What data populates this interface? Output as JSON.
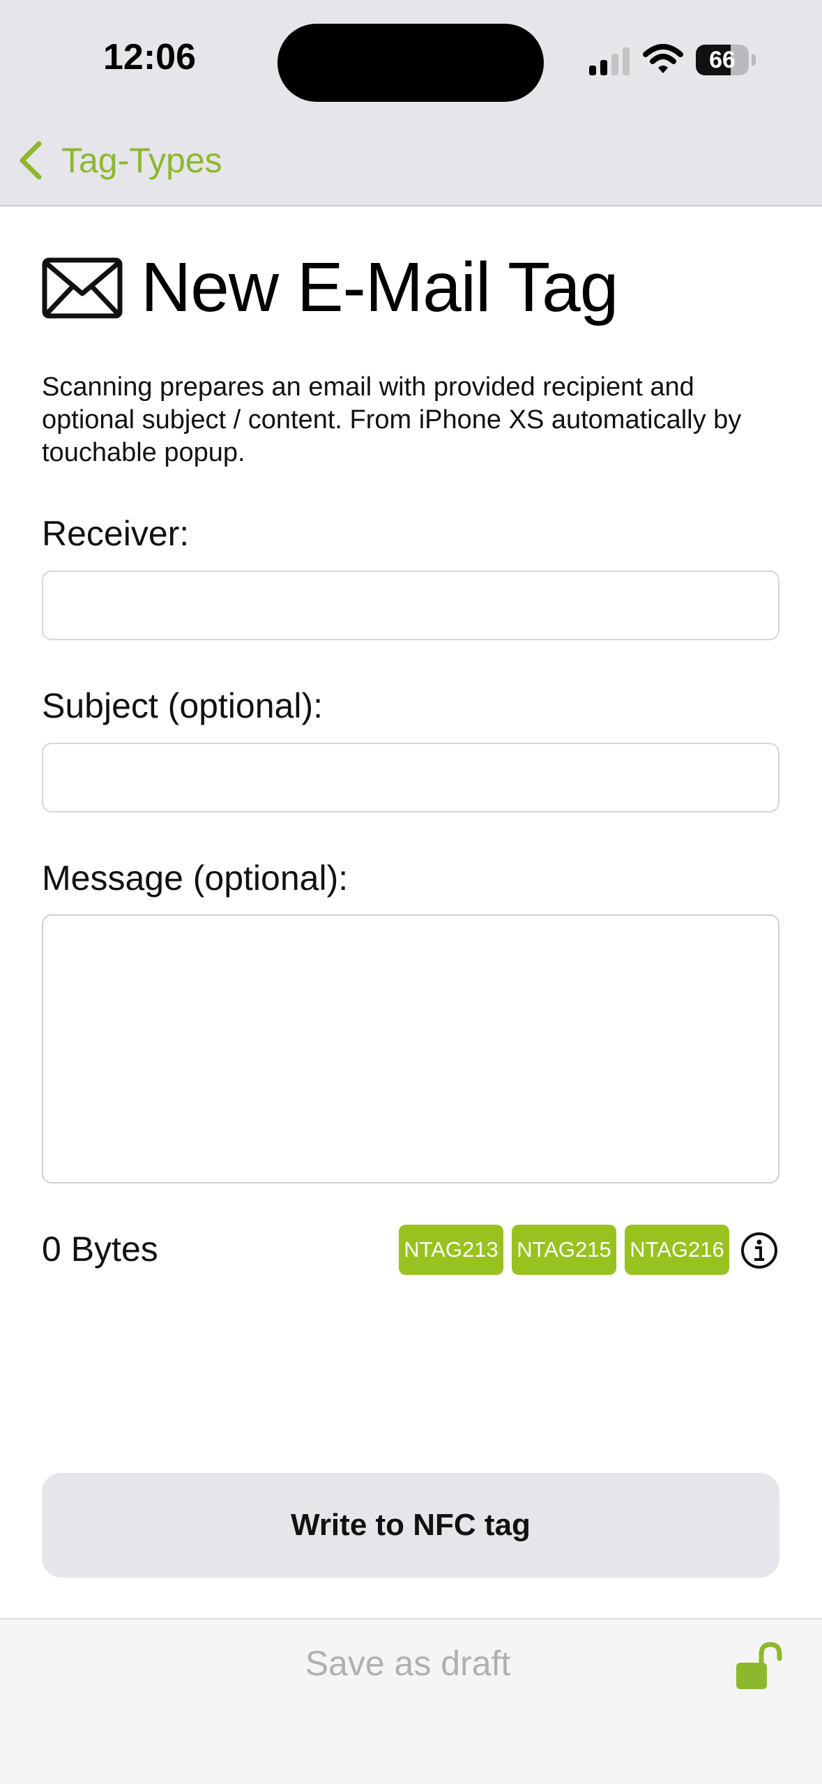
{
  "status_bar": {
    "time": "12:06",
    "battery": "66",
    "battery_level": 66
  },
  "nav": {
    "back_label": "Tag-Types"
  },
  "page": {
    "title": "New E-Mail Tag",
    "description": "Scanning prepares an email with provided recipient and optional subject / content. From iPhone XS automatically by touchable popup."
  },
  "form": {
    "receiver_label": "Receiver:",
    "receiver_value": "",
    "subject_label": "Subject (optional):",
    "subject_value": "",
    "message_label": "Message (optional):",
    "message_value": ""
  },
  "size": {
    "bytes_label": "0 Bytes",
    "chips": [
      "NTAG213",
      "NTAG215",
      "NTAG216"
    ]
  },
  "actions": {
    "write_label": "Write to NFC tag",
    "draft_label": "Save as draft"
  },
  "colors": {
    "accent": "#8db82d",
    "chip": "#98c21f"
  }
}
